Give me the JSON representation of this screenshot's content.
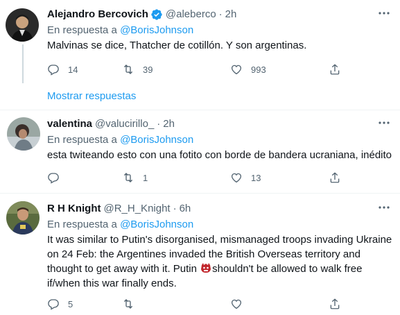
{
  "tweets": [
    {
      "name": "Alejandro Bercovich",
      "verified": true,
      "handle": "@aleberco",
      "sep": "·",
      "time": "2h",
      "reply_prefix": "En respuesta a",
      "reply_mention": "@BorisJohnson",
      "text": "Malvinas se dice, Thatcher de cotillón. Y son argentinas.",
      "replies": "14",
      "retweets": "39",
      "likes": "993",
      "show_replies": "Mostrar respuestas"
    },
    {
      "name": "valentina",
      "handle": "@valucirillo_",
      "sep": "·",
      "time": "2h",
      "reply_prefix": "En respuesta a",
      "reply_mention": "@BorisJohnson",
      "text": "esta twiteando esto con una fotito con borde de bandera ucraniana, inédito",
      "replies": "",
      "retweets": "1",
      "likes": "13"
    },
    {
      "name": "R H Knight",
      "handle": "@R_H_Knight",
      "sep": "·",
      "time": "6h",
      "reply_prefix": "En respuesta a",
      "reply_mention": "@BorisJohnson",
      "text_before_emoji": "It was similar to Putin's disorganised, mismanaged troops invading Ukraine\non 24 Feb: the Argentines invaded the British Overseas territory and\nthought to get away with it. Putin ",
      "text_after_emoji": "shouldn't be allowed to walk free\nif/when this war finally ends.",
      "emoji": "ogre-emoji",
      "replies": "5",
      "retweets": "",
      "likes": ""
    }
  ],
  "colors": {
    "accent": "#1d9bf0",
    "muted": "#536471",
    "divider": "#eff3f4"
  }
}
